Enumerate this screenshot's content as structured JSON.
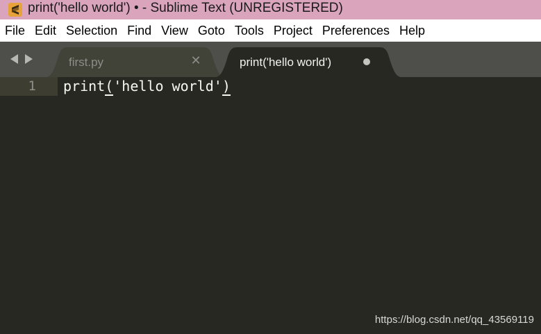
{
  "window": {
    "title": "print('hello world') • - Sublime Text (UNREGISTERED)",
    "icon": "sublime-text-logo-icon",
    "title_bar_color": "#d9a4bc"
  },
  "menu": {
    "items": [
      "File",
      "Edit",
      "Selection",
      "Find",
      "View",
      "Goto",
      "Tools",
      "Project",
      "Preferences",
      "Help"
    ]
  },
  "tabs": {
    "items": [
      {
        "label": "first.py",
        "active": false,
        "dirty": false
      },
      {
        "label": "print('hello world')",
        "active": true,
        "dirty": true
      }
    ],
    "nav_icons": [
      "chevron-left-icon",
      "chevron-right-icon"
    ]
  },
  "editor": {
    "background": "#272822",
    "lines": [
      {
        "number": "1",
        "text": "print('hello world')"
      }
    ],
    "code_parts": {
      "func": "print",
      "open_paren": "(",
      "string": "'hello world'",
      "close_paren": ")"
    }
  },
  "watermark": "https://blog.csdn.net/qq_43569119"
}
